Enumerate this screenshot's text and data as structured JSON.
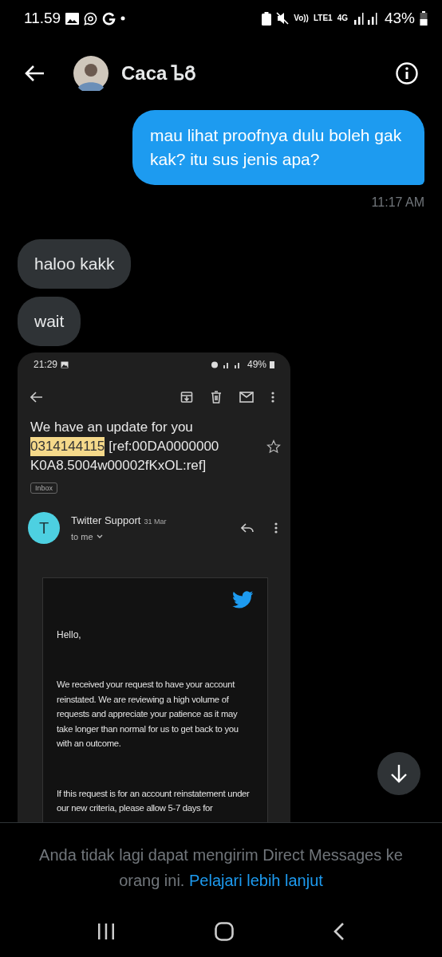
{
  "status_bar": {
    "time": "11.59",
    "network_labels": [
      "Vo))",
      "LTE1",
      "4G"
    ],
    "battery": "43%"
  },
  "header": {
    "name": "Caca ᲆᲒ"
  },
  "messages": [
    {
      "kind": "sent",
      "text": "mau lihat proofnya dulu boleh gak kak? itu sus jenis apa?",
      "time": "11:17 AM"
    },
    {
      "kind": "received",
      "text": "haloo kakk"
    },
    {
      "kind": "received",
      "text": "wait"
    },
    {
      "kind": "image",
      "shot": {
        "status_time": "21:29",
        "status_battery": "49%",
        "subject_line": "We have an update for you",
        "subject_number": "0314144115",
        "subject_ref_1": "[ref:00DA0000000",
        "subject_ref_2": "K0A8.5004w00002fKxOL:ref]",
        "label": "Inbox",
        "starred": false,
        "sender_initial": "T",
        "sender": "Twitter Support",
        "date": "31 Mar",
        "recipient": "to me",
        "greeting": "Hello,",
        "paragraphs": [
          "We received your request to have your account reinstated. We are reviewing a high volume of requests and appreciate your patience as it may take longer than normal for us to get back to you with an outcome.",
          "If this request is for an account reinstatement under our new criteria, please allow 5-7 days for"
        ]
      }
    }
  ],
  "notice": {
    "text": "Anda tidak lagi dapat mengirim Direct Messages ke orang ini.",
    "link": "Pelajari lebih lanjut"
  }
}
